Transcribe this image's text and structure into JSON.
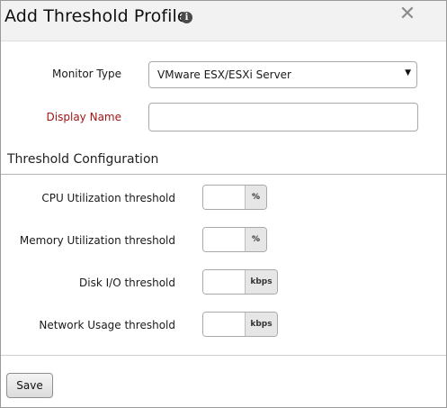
{
  "dialog": {
    "title": "Add Threshold Profile",
    "info_icon": "info-icon",
    "close_icon": "close-icon",
    "close_glyph": "✕"
  },
  "form": {
    "monitor_type_label": "Monitor Type",
    "monitor_type_value": "VMware ESX/ESXi Server",
    "display_name_label": "Display Name",
    "display_name_value": ""
  },
  "threshold_section": {
    "title": "Threshold Configuration",
    "rows": [
      {
        "label": "CPU Utilization threshold",
        "value": "",
        "unit": "%"
      },
      {
        "label": "Memory Utilization threshold",
        "value": "",
        "unit": "%"
      },
      {
        "label": "Disk I/O threshold",
        "value": "",
        "unit": "kbps"
      },
      {
        "label": "Network Usage threshold",
        "value": "",
        "unit": "kbps"
      }
    ]
  },
  "footer": {
    "save_label": "Save"
  },
  "colors": {
    "required_label": "#a31515",
    "header_bg": "#f2f2f2"
  }
}
